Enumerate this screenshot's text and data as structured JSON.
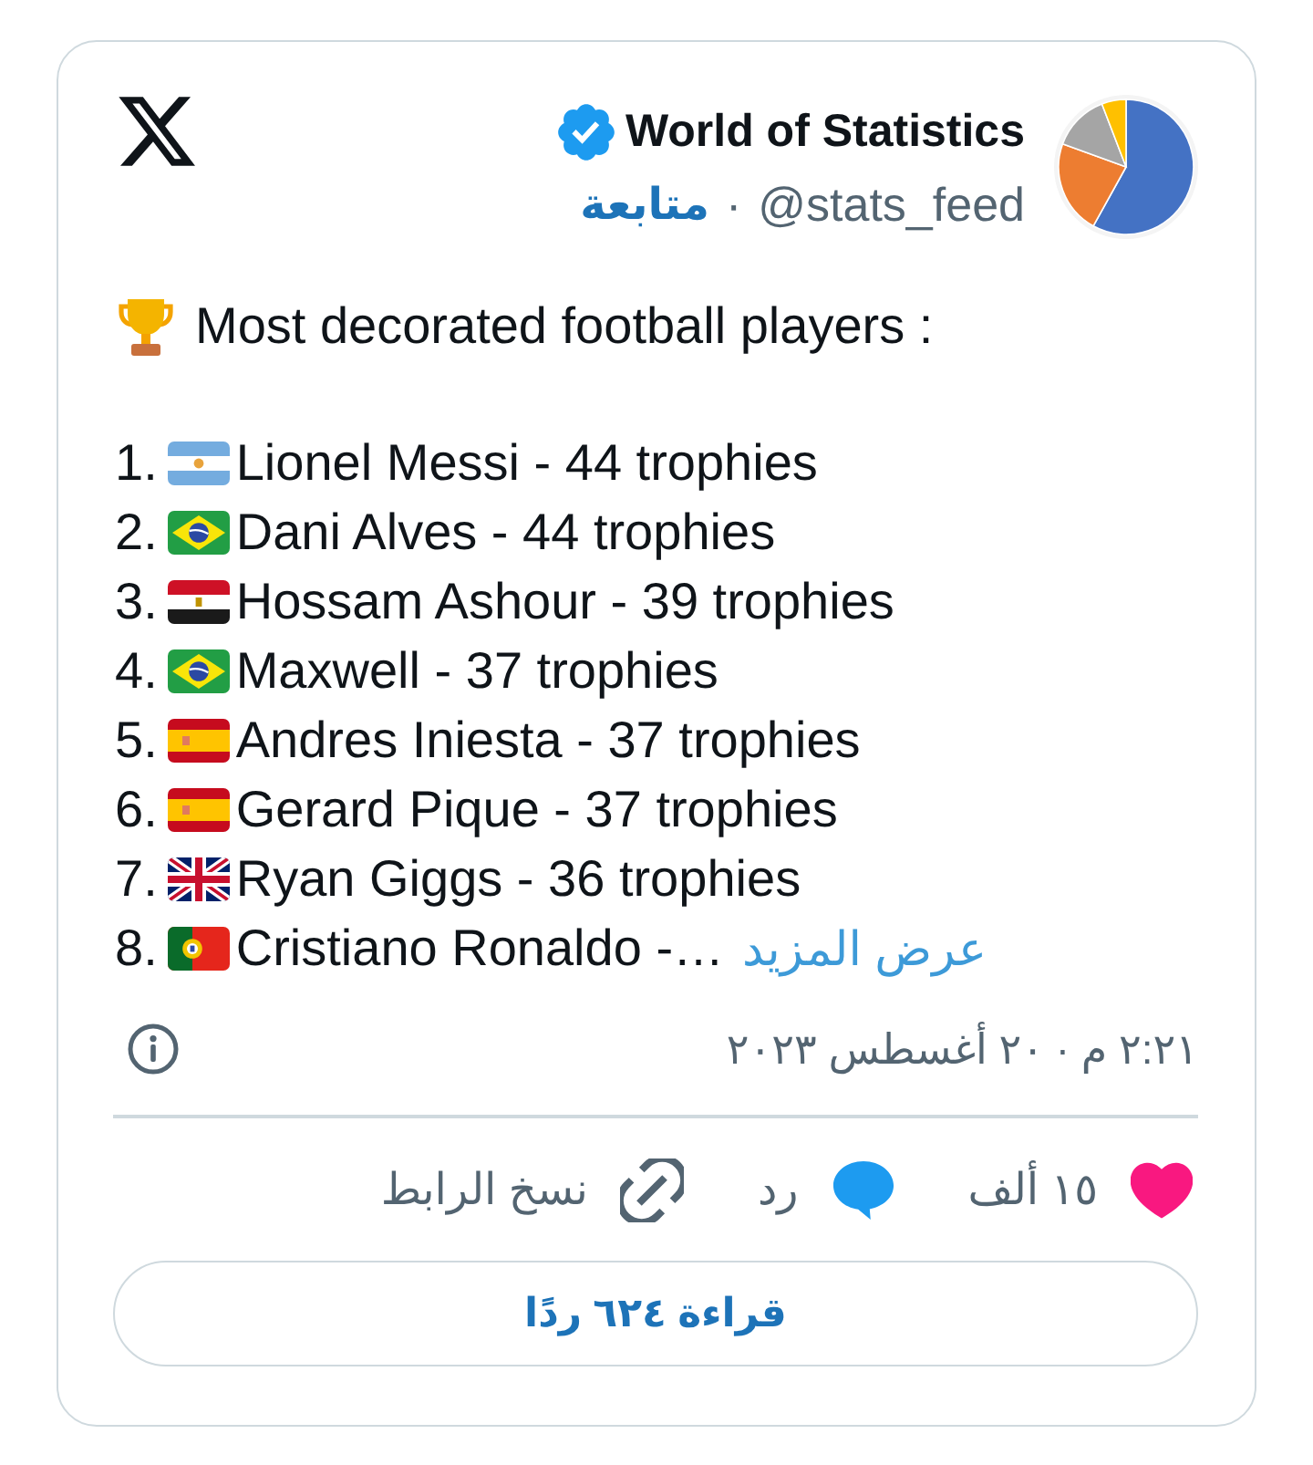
{
  "tweet": {
    "author": {
      "name": "World of Statistics",
      "verified": true,
      "handle": "@stats_feed",
      "separator": "·",
      "follow_link": "متابعة"
    },
    "heading": "Most decorated football players :",
    "list": [
      {
        "rank": "1.",
        "kind": "argentina",
        "text": "Lionel Messi - 44 trophies"
      },
      {
        "rank": "2.",
        "kind": "brazil",
        "text": "Dani Alves - 44 trophies"
      },
      {
        "rank": "3.",
        "kind": "egypt",
        "text": "Hossam Ashour - 39 trophies"
      },
      {
        "rank": "4.",
        "kind": "brazil",
        "text": "Maxwell - 37 trophies"
      },
      {
        "rank": "5.",
        "kind": "spain",
        "text": "Andres Iniesta - 37 trophies"
      },
      {
        "rank": "6.",
        "kind": "spain",
        "text": "Gerard Pique - 37 trophies"
      },
      {
        "rank": "7.",
        "kind": "uk",
        "text": "Ryan Giggs - 36 trophies"
      },
      {
        "rank": "8.",
        "kind": "portugal",
        "text": "Cristiano Ronaldo -…"
      }
    ],
    "show_more": "عرض المزيد",
    "timestamp": "٢:٢١ م · ٢٠ أغسطس ٢٠٢٣",
    "actions": [
      {
        "kind": "like",
        "label": "١٥ ألف"
      },
      {
        "kind": "reply",
        "label": "رد"
      },
      {
        "kind": "copy_link",
        "label": "نسخ الرابط"
      }
    ],
    "read_replies_button": "قراءة ٦٢٤ ردًا"
  }
}
